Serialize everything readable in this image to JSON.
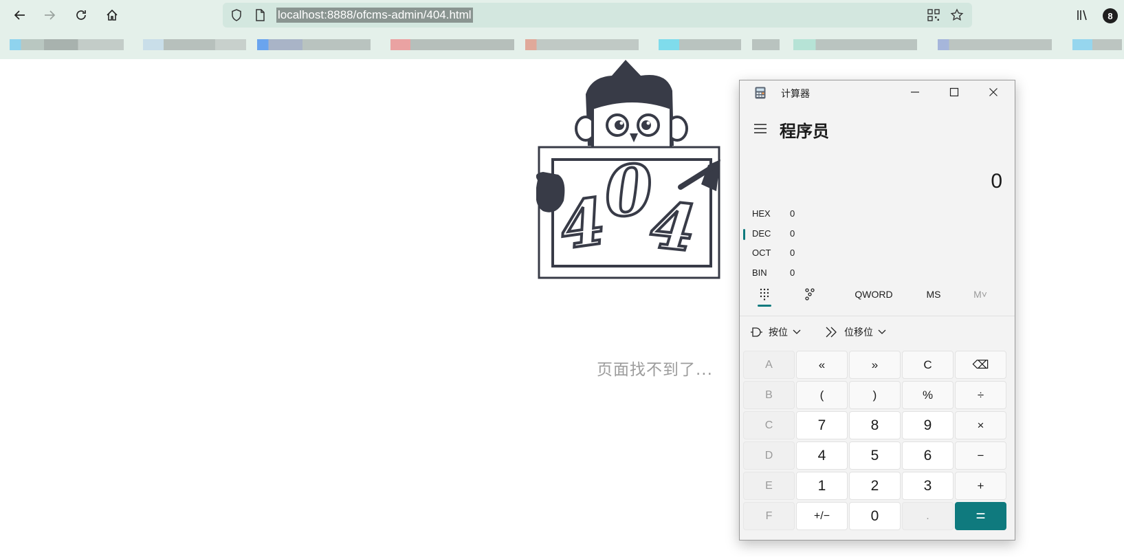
{
  "browser": {
    "url": "localhost:8888/ofcms-admin/404.html",
    "badge_count": "8",
    "icons": [
      "back-icon",
      "forward-icon",
      "reload-icon",
      "home-icon",
      "shield-icon",
      "page-icon",
      "qr-code-icon",
      "bookmark-star-icon",
      "library-icon"
    ]
  },
  "page": {
    "illustration_text": "404",
    "message": "页面找不到了..."
  },
  "calculator": {
    "window_title": "计算器",
    "mode_title": "程序员",
    "display_value": "0",
    "bases": [
      {
        "label": "HEX",
        "value": "0"
      },
      {
        "label": "DEC",
        "value": "0"
      },
      {
        "label": "OCT",
        "value": "0"
      },
      {
        "label": "BIN",
        "value": "0"
      }
    ],
    "selected_base": "DEC",
    "word_size": "QWORD",
    "memory_store": "MS",
    "memory_menu": "M˅",
    "bitwise_label": "按位",
    "bitshift_label": "位移位",
    "keys": {
      "hex_a": "A",
      "lshift": "«",
      "rshift": "»",
      "clear": "C",
      "backspace": "⌫",
      "hex_b": "B",
      "lparen": "(",
      "rparen": ")",
      "percent": "%",
      "divide": "÷",
      "hex_c": "C",
      "n7": "7",
      "n8": "8",
      "n9": "9",
      "multiply": "×",
      "hex_d": "D",
      "n4": "4",
      "n5": "5",
      "n6": "6",
      "minus": "−",
      "hex_e": "E",
      "n1": "1",
      "n2": "2",
      "n3": "3",
      "plus": "+",
      "hex_f": "F",
      "negate": "+/−",
      "n0": "0",
      "decimal": ".",
      "equals": "="
    },
    "accent_color": "#0f7a7e"
  }
}
